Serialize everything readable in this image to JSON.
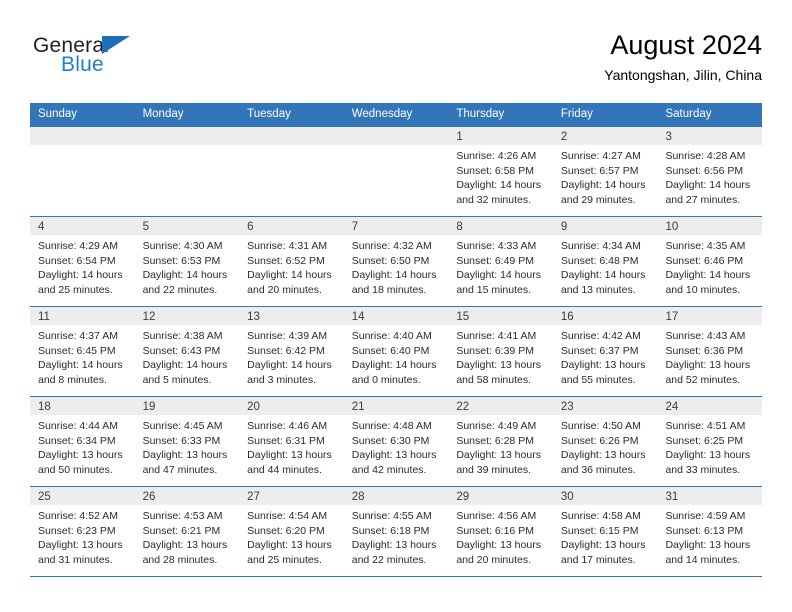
{
  "brand": {
    "name_part1": "General",
    "name_part2": "Blue",
    "triangle_icon": "logo-triangle-icon",
    "accent_color": "#1c7fd0"
  },
  "header": {
    "title": "August 2024",
    "subtitle": "Yantongshan, Jilin, China"
  },
  "theme": {
    "header_blue": "#3275b8",
    "day_band_gray": "#ededed",
    "text_color": "#2b2b2b"
  },
  "weekdays": [
    "Sunday",
    "Monday",
    "Tuesday",
    "Wednesday",
    "Thursday",
    "Friday",
    "Saturday"
  ],
  "weeks": [
    [
      {
        "day": "",
        "empty": true,
        "sunrise": "",
        "sunset": "",
        "daylight_line1": "",
        "daylight_line2": ""
      },
      {
        "day": "",
        "empty": true,
        "sunrise": "",
        "sunset": "",
        "daylight_line1": "",
        "daylight_line2": ""
      },
      {
        "day": "",
        "empty": true,
        "sunrise": "",
        "sunset": "",
        "daylight_line1": "",
        "daylight_line2": ""
      },
      {
        "day": "",
        "empty": true,
        "sunrise": "",
        "sunset": "",
        "daylight_line1": "",
        "daylight_line2": ""
      },
      {
        "day": "1",
        "empty": false,
        "sunrise": "Sunrise: 4:26 AM",
        "sunset": "Sunset: 6:58 PM",
        "daylight_line1": "Daylight: 14 hours",
        "daylight_line2": "and 32 minutes."
      },
      {
        "day": "2",
        "empty": false,
        "sunrise": "Sunrise: 4:27 AM",
        "sunset": "Sunset: 6:57 PM",
        "daylight_line1": "Daylight: 14 hours",
        "daylight_line2": "and 29 minutes."
      },
      {
        "day": "3",
        "empty": false,
        "sunrise": "Sunrise: 4:28 AM",
        "sunset": "Sunset: 6:56 PM",
        "daylight_line1": "Daylight: 14 hours",
        "daylight_line2": "and 27 minutes."
      }
    ],
    [
      {
        "day": "4",
        "empty": false,
        "sunrise": "Sunrise: 4:29 AM",
        "sunset": "Sunset: 6:54 PM",
        "daylight_line1": "Daylight: 14 hours",
        "daylight_line2": "and 25 minutes."
      },
      {
        "day": "5",
        "empty": false,
        "sunrise": "Sunrise: 4:30 AM",
        "sunset": "Sunset: 6:53 PM",
        "daylight_line1": "Daylight: 14 hours",
        "daylight_line2": "and 22 minutes."
      },
      {
        "day": "6",
        "empty": false,
        "sunrise": "Sunrise: 4:31 AM",
        "sunset": "Sunset: 6:52 PM",
        "daylight_line1": "Daylight: 14 hours",
        "daylight_line2": "and 20 minutes."
      },
      {
        "day": "7",
        "empty": false,
        "sunrise": "Sunrise: 4:32 AM",
        "sunset": "Sunset: 6:50 PM",
        "daylight_line1": "Daylight: 14 hours",
        "daylight_line2": "and 18 minutes."
      },
      {
        "day": "8",
        "empty": false,
        "sunrise": "Sunrise: 4:33 AM",
        "sunset": "Sunset: 6:49 PM",
        "daylight_line1": "Daylight: 14 hours",
        "daylight_line2": "and 15 minutes."
      },
      {
        "day": "9",
        "empty": false,
        "sunrise": "Sunrise: 4:34 AM",
        "sunset": "Sunset: 6:48 PM",
        "daylight_line1": "Daylight: 14 hours",
        "daylight_line2": "and 13 minutes."
      },
      {
        "day": "10",
        "empty": false,
        "sunrise": "Sunrise: 4:35 AM",
        "sunset": "Sunset: 6:46 PM",
        "daylight_line1": "Daylight: 14 hours",
        "daylight_line2": "and 10 minutes."
      }
    ],
    [
      {
        "day": "11",
        "empty": false,
        "sunrise": "Sunrise: 4:37 AM",
        "sunset": "Sunset: 6:45 PM",
        "daylight_line1": "Daylight: 14 hours",
        "daylight_line2": "and 8 minutes."
      },
      {
        "day": "12",
        "empty": false,
        "sunrise": "Sunrise: 4:38 AM",
        "sunset": "Sunset: 6:43 PM",
        "daylight_line1": "Daylight: 14 hours",
        "daylight_line2": "and 5 minutes."
      },
      {
        "day": "13",
        "empty": false,
        "sunrise": "Sunrise: 4:39 AM",
        "sunset": "Sunset: 6:42 PM",
        "daylight_line1": "Daylight: 14 hours",
        "daylight_line2": "and 3 minutes."
      },
      {
        "day": "14",
        "empty": false,
        "sunrise": "Sunrise: 4:40 AM",
        "sunset": "Sunset: 6:40 PM",
        "daylight_line1": "Daylight: 14 hours",
        "daylight_line2": "and 0 minutes."
      },
      {
        "day": "15",
        "empty": false,
        "sunrise": "Sunrise: 4:41 AM",
        "sunset": "Sunset: 6:39 PM",
        "daylight_line1": "Daylight: 13 hours",
        "daylight_line2": "and 58 minutes."
      },
      {
        "day": "16",
        "empty": false,
        "sunrise": "Sunrise: 4:42 AM",
        "sunset": "Sunset: 6:37 PM",
        "daylight_line1": "Daylight: 13 hours",
        "daylight_line2": "and 55 minutes."
      },
      {
        "day": "17",
        "empty": false,
        "sunrise": "Sunrise: 4:43 AM",
        "sunset": "Sunset: 6:36 PM",
        "daylight_line1": "Daylight: 13 hours",
        "daylight_line2": "and 52 minutes."
      }
    ],
    [
      {
        "day": "18",
        "empty": false,
        "sunrise": "Sunrise: 4:44 AM",
        "sunset": "Sunset: 6:34 PM",
        "daylight_line1": "Daylight: 13 hours",
        "daylight_line2": "and 50 minutes."
      },
      {
        "day": "19",
        "empty": false,
        "sunrise": "Sunrise: 4:45 AM",
        "sunset": "Sunset: 6:33 PM",
        "daylight_line1": "Daylight: 13 hours",
        "daylight_line2": "and 47 minutes."
      },
      {
        "day": "20",
        "empty": false,
        "sunrise": "Sunrise: 4:46 AM",
        "sunset": "Sunset: 6:31 PM",
        "daylight_line1": "Daylight: 13 hours",
        "daylight_line2": "and 44 minutes."
      },
      {
        "day": "21",
        "empty": false,
        "sunrise": "Sunrise: 4:48 AM",
        "sunset": "Sunset: 6:30 PM",
        "daylight_line1": "Daylight: 13 hours",
        "daylight_line2": "and 42 minutes."
      },
      {
        "day": "22",
        "empty": false,
        "sunrise": "Sunrise: 4:49 AM",
        "sunset": "Sunset: 6:28 PM",
        "daylight_line1": "Daylight: 13 hours",
        "daylight_line2": "and 39 minutes."
      },
      {
        "day": "23",
        "empty": false,
        "sunrise": "Sunrise: 4:50 AM",
        "sunset": "Sunset: 6:26 PM",
        "daylight_line1": "Daylight: 13 hours",
        "daylight_line2": "and 36 minutes."
      },
      {
        "day": "24",
        "empty": false,
        "sunrise": "Sunrise: 4:51 AM",
        "sunset": "Sunset: 6:25 PM",
        "daylight_line1": "Daylight: 13 hours",
        "daylight_line2": "and 33 minutes."
      }
    ],
    [
      {
        "day": "25",
        "empty": false,
        "sunrise": "Sunrise: 4:52 AM",
        "sunset": "Sunset: 6:23 PM",
        "daylight_line1": "Daylight: 13 hours",
        "daylight_line2": "and 31 minutes."
      },
      {
        "day": "26",
        "empty": false,
        "sunrise": "Sunrise: 4:53 AM",
        "sunset": "Sunset: 6:21 PM",
        "daylight_line1": "Daylight: 13 hours",
        "daylight_line2": "and 28 minutes."
      },
      {
        "day": "27",
        "empty": false,
        "sunrise": "Sunrise: 4:54 AM",
        "sunset": "Sunset: 6:20 PM",
        "daylight_line1": "Daylight: 13 hours",
        "daylight_line2": "and 25 minutes."
      },
      {
        "day": "28",
        "empty": false,
        "sunrise": "Sunrise: 4:55 AM",
        "sunset": "Sunset: 6:18 PM",
        "daylight_line1": "Daylight: 13 hours",
        "daylight_line2": "and 22 minutes."
      },
      {
        "day": "29",
        "empty": false,
        "sunrise": "Sunrise: 4:56 AM",
        "sunset": "Sunset: 6:16 PM",
        "daylight_line1": "Daylight: 13 hours",
        "daylight_line2": "and 20 minutes."
      },
      {
        "day": "30",
        "empty": false,
        "sunrise": "Sunrise: 4:58 AM",
        "sunset": "Sunset: 6:15 PM",
        "daylight_line1": "Daylight: 13 hours",
        "daylight_line2": "and 17 minutes."
      },
      {
        "day": "31",
        "empty": false,
        "sunrise": "Sunrise: 4:59 AM",
        "sunset": "Sunset: 6:13 PM",
        "daylight_line1": "Daylight: 13 hours",
        "daylight_line2": "and 14 minutes."
      }
    ]
  ]
}
